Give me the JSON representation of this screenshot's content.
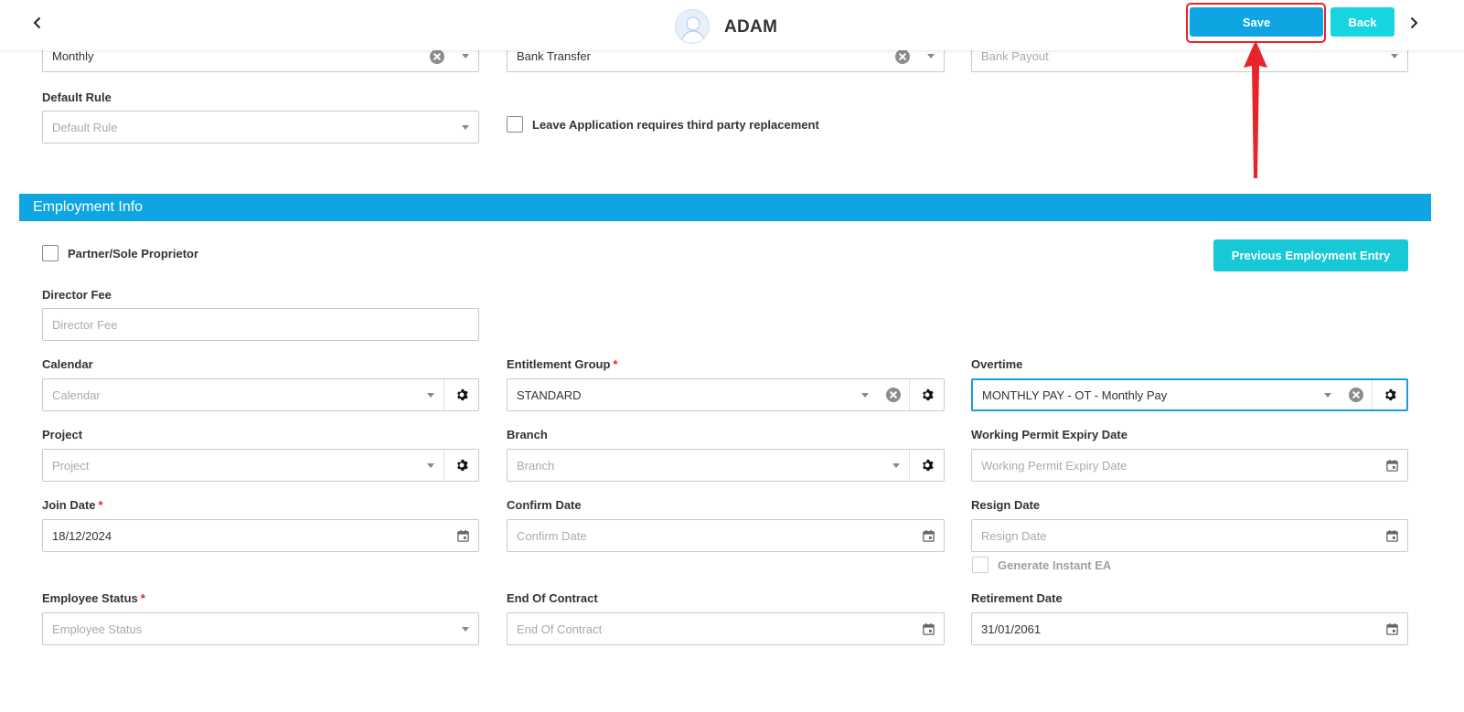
{
  "header": {
    "user_name": "ADAM",
    "save_label": "Save",
    "back_label": "Back"
  },
  "top_fields": {
    "pay_frequency": "Monthly",
    "payment_method": "Bank Transfer",
    "bank_payout_placeholder": "Bank Payout",
    "default_rule_label": "Default Rule",
    "default_rule_placeholder": "Default Rule",
    "leave_third_party_label": "Leave Application requires third party replacement"
  },
  "section": {
    "title": "Employment Info",
    "partner_label": "Partner/Sole Proprietor",
    "prev_employment_label": "Previous Employment Entry"
  },
  "fields": {
    "director_fee": {
      "label": "Director Fee",
      "placeholder": "Director Fee"
    },
    "calendar": {
      "label": "Calendar",
      "placeholder": "Calendar"
    },
    "entitlement_group": {
      "label": "Entitlement Group",
      "value": "STANDARD",
      "required": "*"
    },
    "overtime": {
      "label": "Overtime",
      "value": "MONTHLY PAY - OT - Monthly Pay"
    },
    "project": {
      "label": "Project",
      "placeholder": "Project"
    },
    "branch": {
      "label": "Branch",
      "placeholder": "Branch"
    },
    "working_permit": {
      "label": "Working Permit Expiry Date",
      "placeholder": "Working Permit Expiry Date"
    },
    "join_date": {
      "label": "Join Date",
      "value": "18/12/2024",
      "required": "*"
    },
    "confirm_date": {
      "label": "Confirm Date",
      "placeholder": "Confirm Date"
    },
    "resign_date": {
      "label": "Resign Date",
      "placeholder": "Resign Date"
    },
    "generate_ea_label": "Generate Instant EA",
    "employee_status": {
      "label": "Employee Status",
      "placeholder": "Employee Status",
      "required": "*"
    },
    "end_of_contract": {
      "label": "End Of Contract",
      "placeholder": "End Of Contract"
    },
    "retirement_date": {
      "label": "Retirement Date",
      "value": "31/01/2061"
    }
  },
  "colors": {
    "primary": "#0ea5e2",
    "accent": "#17d5e0",
    "required": "#e8242b",
    "annotation": "#e8242b"
  }
}
